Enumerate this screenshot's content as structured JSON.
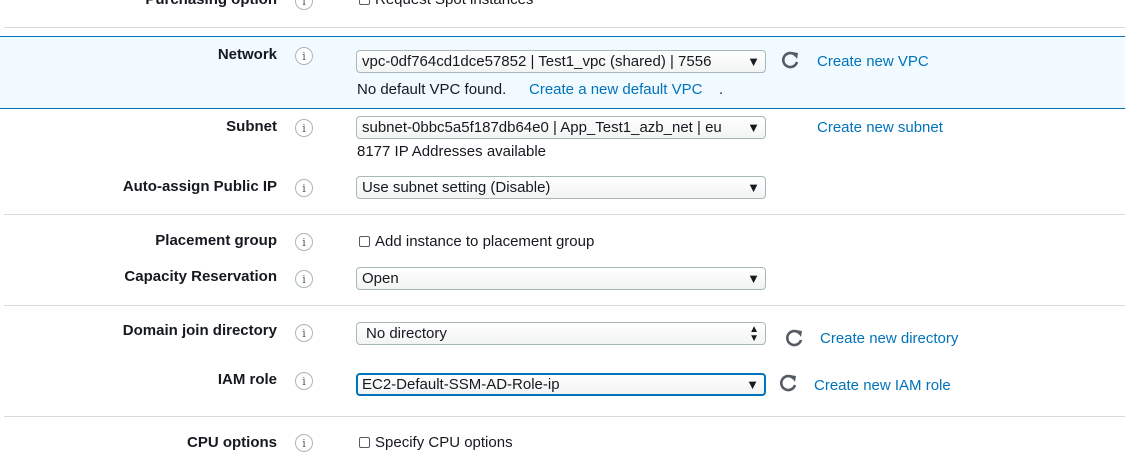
{
  "purchasing_option": {
    "label": "Purchasing option",
    "checkbox_label": "Request Spot instances"
  },
  "network": {
    "label": "Network",
    "selected": "vpc-0df764cd1dce57852 | Test1_vpc (shared) | 7556",
    "create_link": "Create new VPC",
    "no_default_text": "No default VPC found.",
    "create_default_link": "Create a new default VPC",
    "create_default_suffix": "."
  },
  "subnet": {
    "label": "Subnet",
    "selected": "subnet-0bbc5a5f187db64e0 | App_Test1_azb_net | eu",
    "available": "8177 IP Addresses available",
    "create_link": "Create new subnet"
  },
  "auto_assign_ip": {
    "label": "Auto-assign Public IP",
    "selected": "Use subnet setting (Disable)"
  },
  "placement_group": {
    "label": "Placement group",
    "checkbox_label": "Add instance to placement group"
  },
  "capacity_reservation": {
    "label": "Capacity Reservation",
    "selected": "Open"
  },
  "domain_join": {
    "label": "Domain join directory",
    "selected": "No directory",
    "create_link": "Create new directory"
  },
  "iam_role": {
    "label": "IAM role",
    "selected": "EC2-Default-SSM-AD-Role-ip",
    "create_link": "Create new IAM role"
  },
  "cpu_options": {
    "label": "CPU options",
    "checkbox_label": "Specify CPU options"
  },
  "icons": {
    "info": "info-icon",
    "refresh": "refresh-icon",
    "dropdown": "dropdown-arrow-icon"
  },
  "colors": {
    "link": "#0073bb",
    "highlight_bg": "#f1faff",
    "highlight_border": "#0073bb"
  }
}
